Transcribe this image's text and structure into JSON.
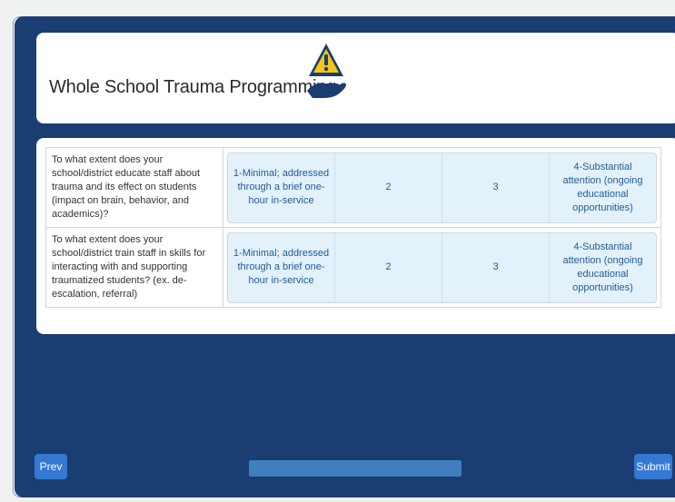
{
  "survey": {
    "title": "Whole School Trauma Programming",
    "header_icon": "hand-warning-icon",
    "colors": {
      "background": "#1a3e72",
      "option_bg": "#e3f1fb",
      "option_text": "#1f5c99",
      "button": "#3578d4",
      "progress": "#3f7fbd",
      "warning_yellow": "#f5c518"
    }
  },
  "matrix": {
    "rows": [
      {
        "question": "To what extent does your school/district educate staff about trauma and its effect on students (impact on brain, behavior, and academics)?",
        "options": [
          "1-Minimal; addressed through a brief one-hour in-service",
          "2",
          "3",
          "4-Substantial attention (ongoing educational opportunities)"
        ]
      },
      {
        "question": "To what extent does your school/district train staff in skills for interacting with and supporting traumatized students? (ex. de-escalation, referral)",
        "options": [
          "1-Minimal; addressed through a brief one-hour in-service",
          "2",
          "3",
          "4-Substantial attention (ongoing educational opportunities)"
        ]
      }
    ]
  },
  "navigation": {
    "prev_label": "Prev",
    "submit_label": "Submit",
    "progress": 1.0
  }
}
